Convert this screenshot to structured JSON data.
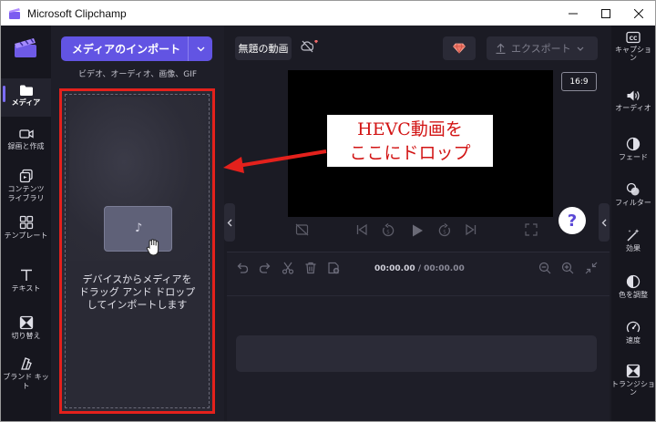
{
  "window": {
    "title": "Microsoft Clipchamp"
  },
  "leftnav": {
    "items": [
      {
        "label": "メディア",
        "icon": "folder-icon"
      },
      {
        "label": "録画と作成",
        "icon": "camera-icon"
      },
      {
        "label": "コンテンツ\nライブラリ",
        "icon": "content-library-icon"
      },
      {
        "label": "テンプレート",
        "icon": "templates-icon"
      },
      {
        "label": "テキスト",
        "icon": "text-icon"
      },
      {
        "label": "切り替え",
        "icon": "transitions-icon"
      },
      {
        "label": "ブランド キット",
        "icon": "brand-kit-icon"
      }
    ]
  },
  "media": {
    "import_label": "メディアのインポート",
    "formats": "ビデオ、オーディオ、画像、GIF",
    "drop_text": "デバイスからメディアを\nドラッグ アンド ドロップ\nしてインポートします"
  },
  "topbar": {
    "project_name": "無題の動画",
    "export_label": "エクスポート"
  },
  "preview": {
    "aspect_ratio": "16:9"
  },
  "annotation": {
    "text": "HEVC動画を\nここにドロップ",
    "color": "#d21414"
  },
  "help": {
    "label": "?"
  },
  "timeline": {
    "current": "00:00.00",
    "separator": " / ",
    "total": "00:00.00"
  },
  "rightnav": {
    "items": [
      {
        "label": "キャプショ\nン",
        "icon": "captions-icon"
      },
      {
        "label": "オーディオ",
        "icon": "audio-icon"
      },
      {
        "label": "フェード",
        "icon": "fade-icon"
      },
      {
        "label": "フィルター",
        "icon": "filters-icon"
      },
      {
        "label": "効果",
        "icon": "effects-icon"
      },
      {
        "label": "色を調整",
        "icon": "color-adjust-icon"
      },
      {
        "label": "速度",
        "icon": "speed-icon"
      },
      {
        "label": "トランジショ\nン",
        "icon": "transition-icon"
      }
    ]
  },
  "colors": {
    "accent": "#6254e3",
    "highlight_border": "#e4211c",
    "background": "#1b1b24"
  }
}
